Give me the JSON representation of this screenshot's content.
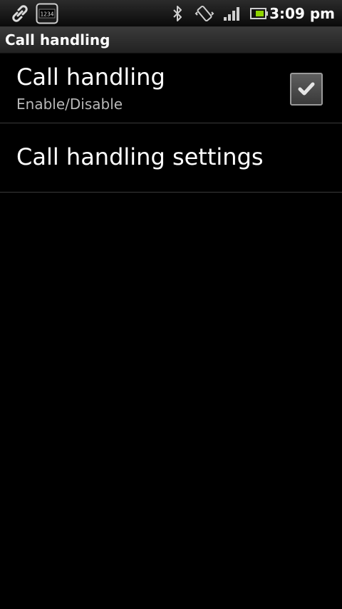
{
  "status_bar": {
    "time": "3:09 pm",
    "icons": [
      "link-icon",
      "dock-clock-icon",
      "bluetooth-icon",
      "vibrate-icon",
      "signal-icon",
      "battery-icon"
    ],
    "dock_label": "1234"
  },
  "header": {
    "title": "Call handling"
  },
  "list": {
    "items": [
      {
        "title": "Call handling",
        "summary": "Enable/Disable",
        "checked": true
      },
      {
        "title": "Call handling settings"
      }
    ]
  },
  "colors": {
    "background": "#000000",
    "text_primary": "#ffffff",
    "text_secondary": "#b8b8b8",
    "divider": "#3a3a3a"
  }
}
